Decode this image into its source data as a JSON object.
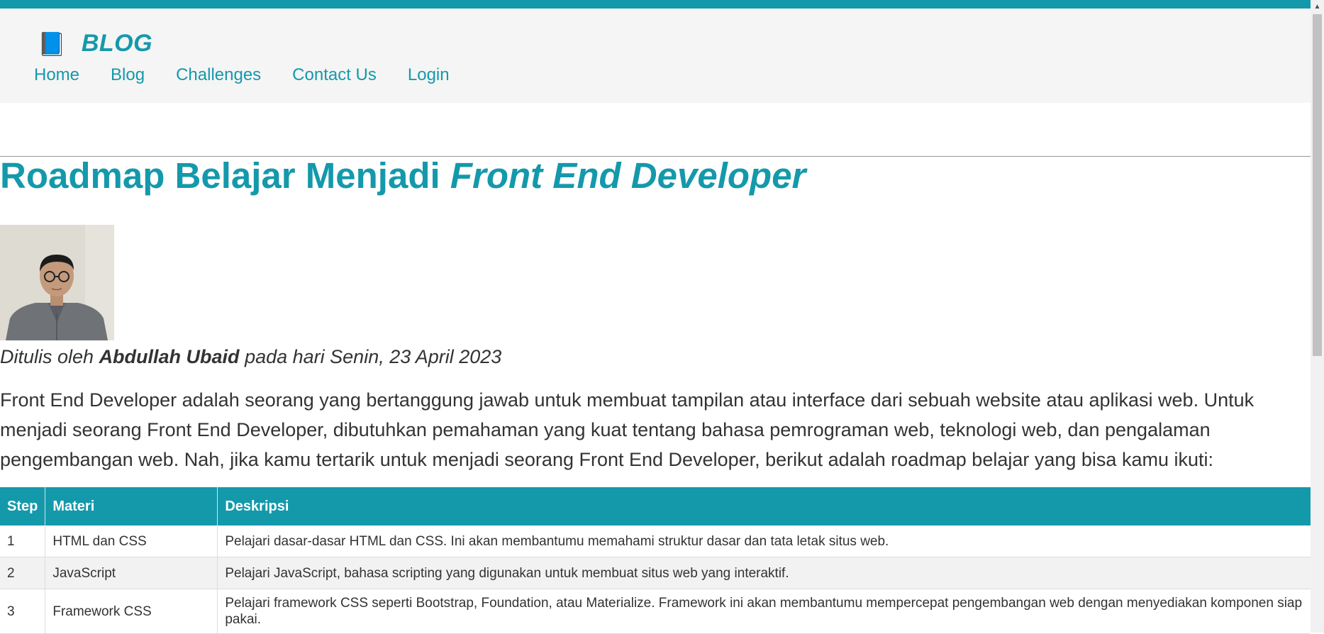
{
  "header": {
    "brand_icon": "📘",
    "brand_text": "BLOG",
    "nav": [
      {
        "label": "Home"
      },
      {
        "label": "Blog"
      },
      {
        "label": "Challenges"
      },
      {
        "label": "Contact Us"
      },
      {
        "label": "Login"
      }
    ]
  },
  "article": {
    "title_plain": "Roadmap Belajar Menjadi ",
    "title_emphasis": "Front End Developer",
    "byline_prefix": "Ditulis oleh ",
    "author": "Abdullah Ubaid",
    "byline_suffix": " pada hari Senin, 23 April 2023",
    "intro": "Front End Developer adalah seorang yang bertanggung jawab untuk membuat tampilan atau interface dari sebuah website atau aplikasi web. Untuk menjadi seorang Front End Developer, dibutuhkan pemahaman yang kuat tentang bahasa pemrograman web, teknologi web, dan pengalaman pengembangan web. Nah, jika kamu tertarik untuk menjadi seorang Front End Developer, berikut adalah roadmap belajar yang bisa kamu ikuti:"
  },
  "table": {
    "headers": [
      "Step",
      "Materi",
      "Deskripsi"
    ],
    "rows": [
      {
        "step": "1",
        "materi": "HTML dan CSS",
        "deskripsi": "Pelajari dasar-dasar HTML dan CSS. Ini akan membantumu memahami struktur dasar dan tata letak situs web."
      },
      {
        "step": "2",
        "materi": "JavaScript",
        "deskripsi": "Pelajari JavaScript, bahasa scripting yang digunakan untuk membuat situs web yang interaktif."
      },
      {
        "step": "3",
        "materi": "Framework CSS",
        "deskripsi": "Pelajari framework CSS seperti Bootstrap, Foundation, atau Materialize. Framework ini akan membantumu mempercepat pengembangan web dengan menyediakan komponen siap pakai."
      }
    ]
  },
  "colors": {
    "accent": "#1499ab",
    "header_bg": "#f5f5f5",
    "text": "#333333"
  },
  "icons": {
    "brand": "book-icon",
    "author_photo": "author-photo",
    "scroll_up": "chevron-up-icon"
  }
}
